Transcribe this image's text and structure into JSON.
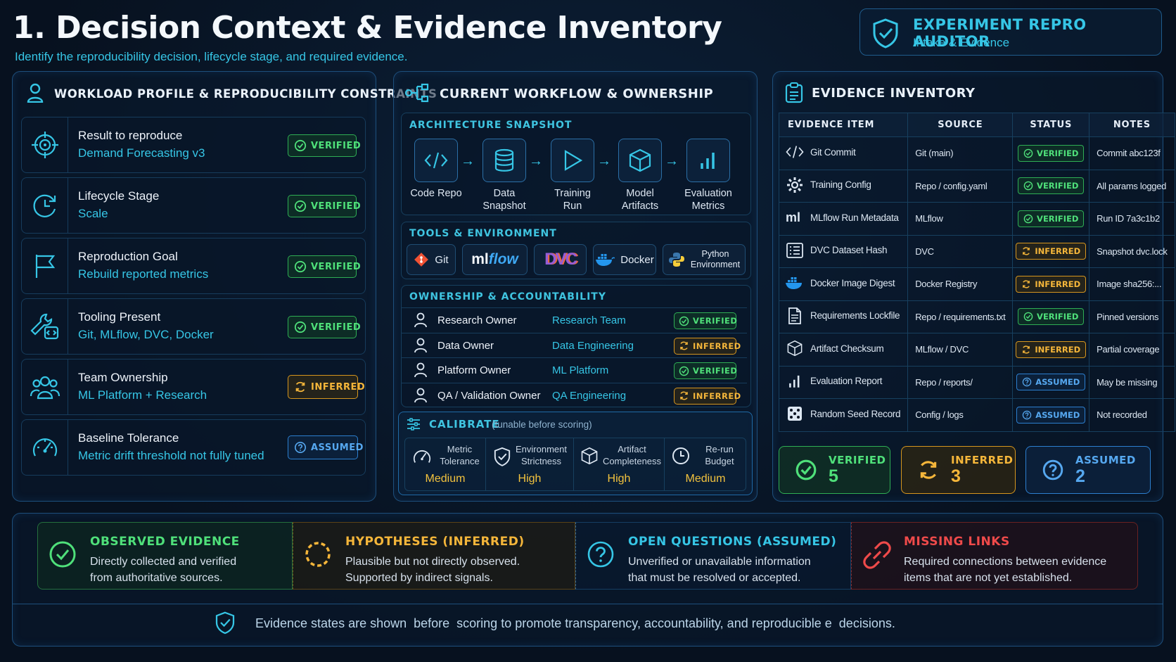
{
  "header": {
    "title": "1. Decision Context & Evidence Inventory",
    "subtitle": "Identify the reproducibility decision, lifecycle stage, and required evidence.",
    "app_name": "EXPERIMENT REPRO AUDITOR",
    "app_subtitle": "Intake & Evidence"
  },
  "workload": {
    "title": "WORKLOAD PROFILE & REPRODUCIBILITY CONSTRAINTS",
    "rows": [
      {
        "label": "Result to reproduce",
        "value": "Demand Forecasting v3",
        "status": "VERIFIED",
        "icon": "target-icon"
      },
      {
        "label": "Lifecycle Stage",
        "value": "Scale",
        "status": "VERIFIED",
        "icon": "cycle-clock-icon"
      },
      {
        "label": "Reproduction Goal",
        "value": "Rebuild reported metrics",
        "status": "VERIFIED",
        "icon": "flag-icon"
      },
      {
        "label": "Tooling Present",
        "value": "Git, MLflow, DVC, Docker",
        "status": "VERIFIED",
        "icon": "wrench-code-icon"
      },
      {
        "label": "Team Ownership",
        "value": "ML Platform + Research",
        "status": "INFERRED",
        "icon": "team-icon"
      },
      {
        "label": "Baseline Tolerance",
        "value": "Metric drift threshold not fully tuned",
        "status": "ASSUMED",
        "icon": "gauge-icon"
      }
    ]
  },
  "workflow": {
    "title": "CURRENT WORKFLOW & OWNERSHIP",
    "architecture_title": "ARCHITECTURE SNAPSHOT",
    "steps": [
      {
        "line1": "Code Repo",
        "line2": "",
        "icon": "code-icon"
      },
      {
        "line1": "Data",
        "line2": "Snapshot",
        "icon": "database-icon"
      },
      {
        "line1": "Training",
        "line2": "Run",
        "icon": "play-icon"
      },
      {
        "line1": "Model",
        "line2": "Artifacts",
        "icon": "cube-icon"
      },
      {
        "line1": "Evaluation",
        "line2": "Metrics",
        "icon": "bar-chart-icon"
      }
    ],
    "arrow": "→",
    "tools_title": "TOOLS & ENVIRONMENT",
    "tools": [
      {
        "label": "Git",
        "icon": "git-icon"
      },
      {
        "label_a": "ml",
        "label_b": "flow",
        "icon": "mlflow-logo"
      },
      {
        "label": "DVC",
        "icon": "dvc-logo"
      },
      {
        "label": "Docker",
        "icon": "docker-icon"
      },
      {
        "line1": "Python",
        "line2": "Environment",
        "icon": "python-icon"
      }
    ],
    "ownership_title": "OWNERSHIP & ACCOUNTABILITY",
    "owners": [
      {
        "role": "Research Owner",
        "team": "Research Team",
        "status": "VERIFIED"
      },
      {
        "role": "Data Owner",
        "team": "Data Engineering",
        "status": "INFERRED"
      },
      {
        "role": "Platform Owner",
        "team": "ML Platform",
        "status": "VERIFIED"
      },
      {
        "role": "QA / Validation Owner",
        "team": "QA Engineering",
        "status": "INFERRED"
      }
    ],
    "calibrate_title": "CALIBRATE",
    "calibrate_note": "(tunable before scoring)",
    "calibrate": [
      {
        "line1": "Metric",
        "line2": "Tolerance",
        "value": "Medium",
        "icon": "gauge-icon"
      },
      {
        "line1": "Environment",
        "line2": "Strictness",
        "value": "High",
        "icon": "shield-check-icon"
      },
      {
        "line1": "Artifact",
        "line2": "Completeness",
        "value": "High",
        "icon": "cube-icon"
      },
      {
        "line1": "Re-run",
        "line2": "Budget",
        "value": "Medium",
        "icon": "clock-icon"
      }
    ]
  },
  "evidence": {
    "title": "EVIDENCE INVENTORY",
    "columns": [
      "EVIDENCE ITEM",
      "SOURCE",
      "STATUS",
      "NOTES"
    ],
    "rows": [
      {
        "item": "Git Commit",
        "source": "Git (main)",
        "status": "VERIFIED",
        "notes": "Commit abc123f",
        "icon": "code-icon"
      },
      {
        "item": "Training Config",
        "source": "Repo / config.yaml",
        "status": "VERIFIED",
        "notes": "All params logged",
        "icon": "gear-icon"
      },
      {
        "item": "MLflow Run Metadata",
        "source": "MLflow",
        "status": "VERIFIED",
        "notes": "Run ID 7a3c1b2",
        "icon": "ml-icon"
      },
      {
        "item": "DVC Dataset Hash",
        "source": "DVC",
        "status": "INFERRED",
        "notes": "Snapshot dvc.lock",
        "icon": "list-icon"
      },
      {
        "item": "Docker Image Digest",
        "source": "Docker Registry",
        "status": "INFERRED",
        "notes": "Image sha256:...",
        "icon": "docker-icon"
      },
      {
        "item": "Requirements Lockfile",
        "source": "Repo / requirements.txt",
        "status": "VERIFIED",
        "notes": "Pinned versions",
        "icon": "document-icon"
      },
      {
        "item": "Artifact Checksum",
        "source": "MLflow / DVC",
        "status": "INFERRED",
        "notes": "Partial coverage",
        "icon": "cube-icon"
      },
      {
        "item": "Evaluation Report",
        "source": "Repo / reports/",
        "status": "ASSUMED",
        "notes": "May be missing",
        "icon": "bar-chart-icon"
      },
      {
        "item": "Random Seed Record",
        "source": "Config / logs",
        "status": "ASSUMED",
        "notes": "Not recorded",
        "icon": "dice-icon"
      }
    ],
    "summary": [
      {
        "label": "VERIFIED",
        "count": "5"
      },
      {
        "label": "INFERRED",
        "count": "3"
      },
      {
        "label": "ASSUMED",
        "count": "2"
      }
    ]
  },
  "legend": [
    {
      "title": "OBSERVED EVIDENCE",
      "line1": "Directly collected and verified",
      "line2": "from authoritative sources."
    },
    {
      "title": "HYPOTHESES (INFERRED)",
      "line1": "Plausible but not directly observed.",
      "line2": "Supported by indirect signals."
    },
    {
      "title": "OPEN QUESTIONS (ASSUMED)",
      "line1": "Unverified or unavailable information",
      "line2": "that must be resolved or accepted."
    },
    {
      "title": "MISSING LINKS",
      "line1": "Required connections between evidence",
      "line2": "items that are not yet established."
    }
  ],
  "footer": {
    "text": "Evidence states are shown  before  scoring to promote transparency, accountability, and reproducible e  decisions."
  },
  "colors": {
    "background": "#07111f",
    "accent": "#36c6e6",
    "verified": "#4fe07a",
    "inferred": "#f5b63a",
    "assumed": "#56a8f0",
    "missing": "#ef4a4a"
  }
}
